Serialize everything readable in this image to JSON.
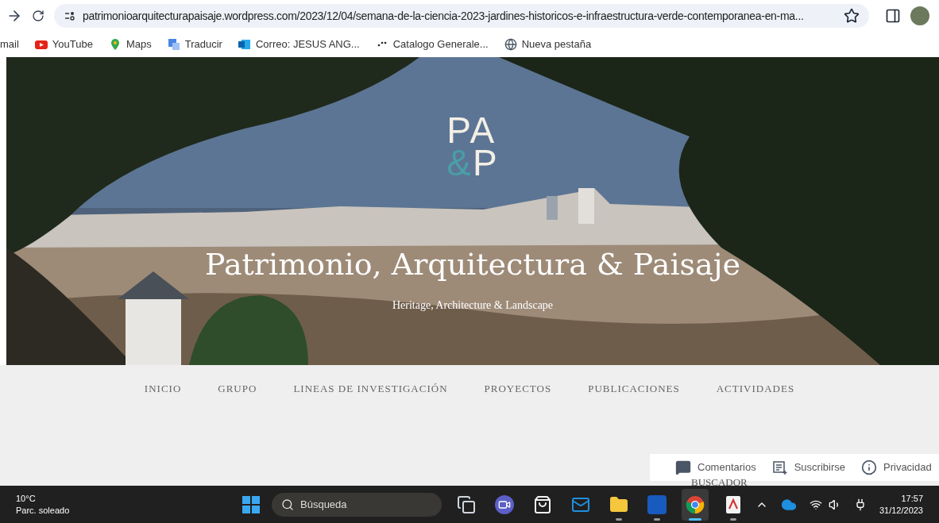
{
  "browser": {
    "url": "patrimonioarquitecturapaisaje.wordpress.com/2023/12/04/semana-de-la-ciencia-2023-jardines-historicos-e-infraestructura-verde-contemporanea-en-ma...",
    "bookmarks": [
      {
        "label": "mail",
        "kind": "none"
      },
      {
        "label": "YouTube",
        "kind": "youtube"
      },
      {
        "label": "Maps",
        "kind": "maps"
      },
      {
        "label": "Traducir",
        "kind": "translate"
      },
      {
        "label": "Correo: JESUS ANG...",
        "kind": "mail"
      },
      {
        "label": "Catalogo Generale...",
        "kind": "dots"
      },
      {
        "label": "Nueva pestaña",
        "kind": "globe"
      }
    ]
  },
  "header": {
    "logo_top": "PA",
    "logo_amp": "&",
    "logo_bottom": "P",
    "title": "Patrimonio, Arquitectura & Paisaje",
    "tagline": "Heritage, Architecture & Landscape"
  },
  "nav": [
    "INICIO",
    "GRUPO",
    "LINEAS DE INVESTIGACIÓN",
    "PROYECTOS",
    "PUBLICACIONES",
    "ACTIVIDADES"
  ],
  "sidebar_heading": "BUSCADOR",
  "follow_bar": [
    {
      "label": "Comentarios",
      "kind": "comment"
    },
    {
      "label": "Suscribirse",
      "kind": "subscribe"
    },
    {
      "label": "Privacidad",
      "kind": "info"
    }
  ],
  "taskbar": {
    "temperature": "10°C",
    "weather": "Parc. soleado",
    "search": "Búsqueda",
    "apps": [
      {
        "kind": "taskview",
        "running": false,
        "selected": false
      },
      {
        "kind": "meet",
        "running": false,
        "selected": false
      },
      {
        "kind": "store",
        "running": false,
        "selected": false
      },
      {
        "kind": "mail",
        "running": false,
        "selected": false
      },
      {
        "kind": "folder",
        "running": true,
        "selected": false
      },
      {
        "kind": "word",
        "running": true,
        "selected": false
      },
      {
        "kind": "chrome",
        "running": true,
        "selected": true
      },
      {
        "kind": "pdf",
        "running": true,
        "selected": false
      }
    ],
    "time": "17:57",
    "date": "31/12/2023"
  }
}
